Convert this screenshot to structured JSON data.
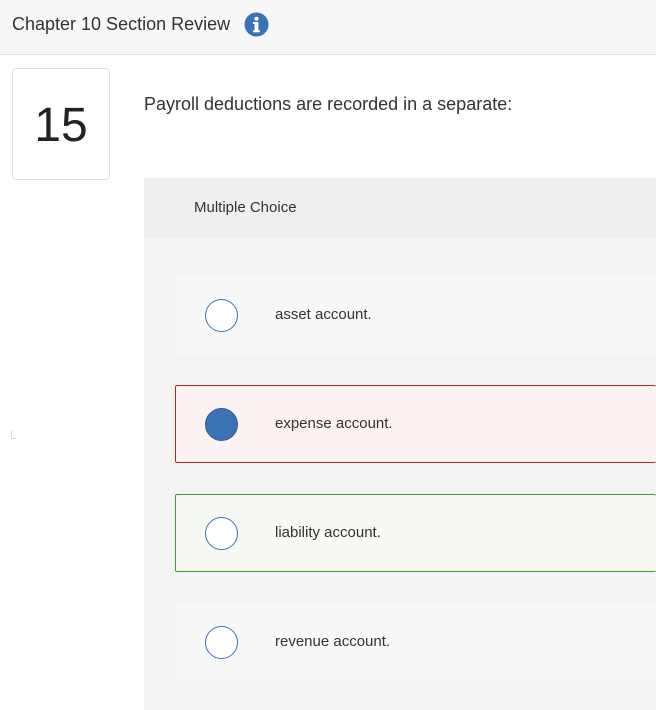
{
  "header": {
    "title": "Chapter 10 Section Review",
    "info_icon": "info-icon",
    "accent_color": "#3b72b4"
  },
  "question": {
    "number": "15",
    "prompt": "Payroll deductions are recorded in a separate:",
    "type_label": "Multiple Choice"
  },
  "options": [
    {
      "label": "asset account.",
      "state": "unselected"
    },
    {
      "label": "expense account.",
      "state": "selected-incorrect",
      "border_color": "#b3262c"
    },
    {
      "label": "liability account.",
      "state": "correct-answer",
      "border_color": "#3f9b30"
    },
    {
      "label": "revenue account.",
      "state": "unselected"
    }
  ]
}
